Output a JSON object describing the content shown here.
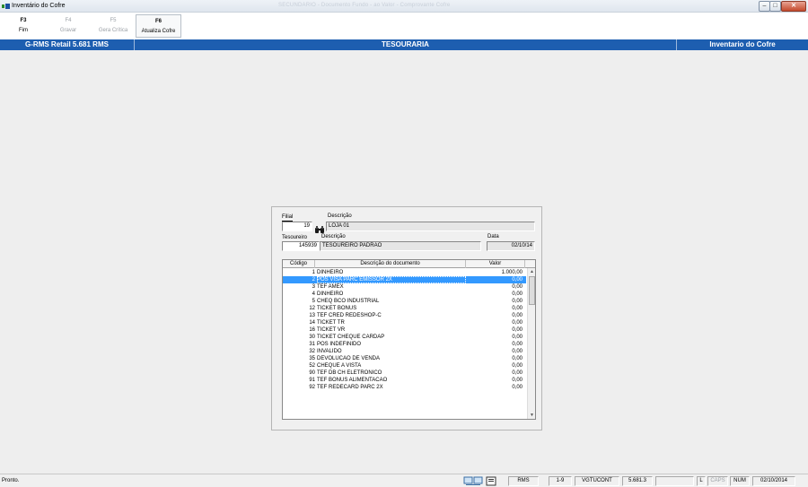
{
  "window": {
    "title": "Inventário do Cofre",
    "blurred_title": "SECUNDARIO - Documento Fundo - ao Valor - Comprovante Cofre",
    "minimize_glyph": "‒",
    "maximize_glyph": "□",
    "close_glyph": "✕"
  },
  "toolbar": {
    "keys": [
      {
        "key": "F3",
        "label": "Fim",
        "enabled": true
      },
      {
        "key": "F4",
        "label": "Gravar",
        "enabled": false
      },
      {
        "key": "F5",
        "label": "Gera Crítica",
        "enabled": false
      },
      {
        "key": "F6",
        "label": "Atualiza Cofre",
        "enabled": true
      }
    ]
  },
  "header": {
    "left": "G-RMS Retail 5.681 RMS",
    "center": "TESOURARIA",
    "right": "Inventario do Cofre"
  },
  "form": {
    "filial_label": "Filial",
    "filial_value": "19",
    "descricao_label": "Descrição",
    "filial_desc": "LOJA 01",
    "tesoureiro_label": "Tesoureiro",
    "tesoureiro_value": "145939",
    "tesoureiro_desc_label": "Descrição",
    "tesoureiro_desc": "TESOUREIRO PADRAO",
    "data_label": "Data",
    "data_value": "02/10/14"
  },
  "grid": {
    "headers": {
      "code": "Código",
      "desc": "Descrição do documento",
      "value": "Valor"
    },
    "selected_index": 1,
    "rows": [
      {
        "code": "1",
        "desc": "DINHEIRO",
        "value": "1.000,00"
      },
      {
        "code": "2",
        "desc": "POS VISA PARC EMISSOR 2X",
        "value": "0,00"
      },
      {
        "code": "3",
        "desc": "TEF AMEX",
        "value": "0,00"
      },
      {
        "code": "4",
        "desc": "DINHEIRO",
        "value": "0,00"
      },
      {
        "code": "5",
        "desc": "CHEQ BCO INDUSTRIAL",
        "value": "0,00"
      },
      {
        "code": "12",
        "desc": "TICKET BONUS",
        "value": "0,00"
      },
      {
        "code": "13",
        "desc": "TEF CRED REDESHOP-C",
        "value": "0,00"
      },
      {
        "code": "14",
        "desc": "TICKET TR",
        "value": "0,00"
      },
      {
        "code": "16",
        "desc": "TICKET VR",
        "value": "0,00"
      },
      {
        "code": "30",
        "desc": "TICKET CHEQUE CARDAP",
        "value": "0,00"
      },
      {
        "code": "31",
        "desc": "POS INDEFINIDO",
        "value": "0,00"
      },
      {
        "code": "32",
        "desc": "INVALIDO",
        "value": "0,00"
      },
      {
        "code": "35",
        "desc": "DEVOLUCAO DE VENDA",
        "value": "0,00"
      },
      {
        "code": "52",
        "desc": "CHEQUE A VISTA",
        "value": "0,00"
      },
      {
        "code": "90",
        "desc": "TEF DB CH ELETRONICO",
        "value": "0,00"
      },
      {
        "code": "91",
        "desc": "TEF BONUS ALIMENTACAO",
        "value": "0,00"
      },
      {
        "code": "92",
        "desc": "TEF REDECARD PARC 2X",
        "value": "0,00"
      }
    ]
  },
  "statusbar": {
    "text": "Pronto.",
    "user": "RMS",
    "range": "1-9",
    "login": "VGTUCONT",
    "version": "5.681.3",
    "blank": "",
    "l": "L",
    "caps": "CAPS",
    "num": "NUM",
    "date": "02/10/2014"
  }
}
